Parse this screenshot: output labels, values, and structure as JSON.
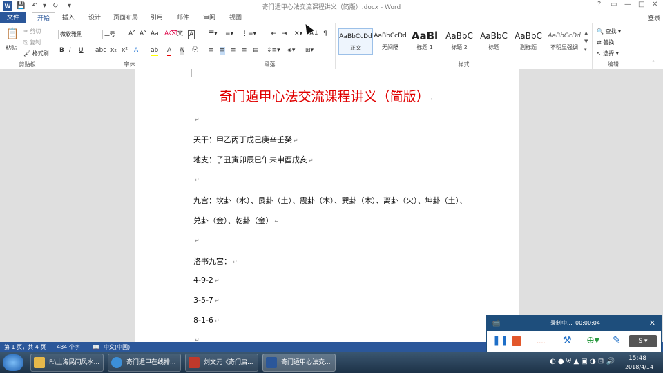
{
  "window": {
    "title": "奇门遁甲心法交流课程讲义（简版）.docx - Word",
    "controls": [
      "?",
      "▭",
      "—",
      "□",
      "✕"
    ]
  },
  "quick_access": {
    "save": "save-icon",
    "undo": "undo-icon",
    "redo": "redo-icon"
  },
  "tabs": [
    "文件",
    "开始",
    "插入",
    "设计",
    "页面布局",
    "引用",
    "邮件",
    "审阅",
    "视图"
  ],
  "login": "登录",
  "ribbon": {
    "clipboard": {
      "label": "剪贴板",
      "paste": "粘贴",
      "cut": "剪切",
      "copy": "复制",
      "format_painter": "格式刷"
    },
    "font": {
      "label": "字体",
      "font_name": "微软雅黑",
      "font_size": "二号"
    },
    "paragraph": {
      "label": "段落"
    },
    "styles": {
      "label": "样式",
      "items": [
        {
          "preview": "AaBbCcDd",
          "name": "正文"
        },
        {
          "preview": "AaBbCcDd",
          "name": "无间隔"
        },
        {
          "preview": "AaBl",
          "name": "标题 1"
        },
        {
          "preview": "AaBbC",
          "name": "标题 2"
        },
        {
          "preview": "AaBbC",
          "name": "标题"
        },
        {
          "preview": "AaBbC",
          "name": "副标题"
        },
        {
          "preview": "AaBbCcDd",
          "name": "不明显强调"
        }
      ]
    },
    "editing": {
      "label": "编辑",
      "find": "查找",
      "replace": "替换",
      "select": "选择"
    }
  },
  "document": {
    "title": "奇门遁甲心法交流课程讲义（简版）",
    "paragraphs": [
      "",
      "天干：甲乙丙丁戊己庚辛壬癸",
      "地支：子丑寅卯辰巳午未申酉戌亥",
      "",
      "九宫：坎卦（水）、艮卦（土）、震卦（木）、巽卦（木）、离卦（火）、坤卦（土）、",
      "兑卦（金）、乾卦（金）",
      "",
      "洛书九宫：",
      "4-9-2",
      "3-5-7",
      "8-1-6",
      ""
    ]
  },
  "status": {
    "page": "第 1 页，共 4 页",
    "words": "484 个字",
    "language": "中文(中国)"
  },
  "recorder": {
    "status": "录制中...",
    "time": "00:00:04"
  },
  "taskbar": {
    "buttons": [
      {
        "label": "F:\\上海民间风水...",
        "color": "#e6b84a"
      },
      {
        "label": "奇门遁甲在线排...",
        "color": "#3c8fd8"
      },
      {
        "label": "刘文元《奇门启...",
        "color": "#c0392b"
      },
      {
        "label": "奇门遁甲心法交...",
        "color": "#2b579a"
      }
    ],
    "time": "15:48",
    "date": "2018/4/14"
  }
}
